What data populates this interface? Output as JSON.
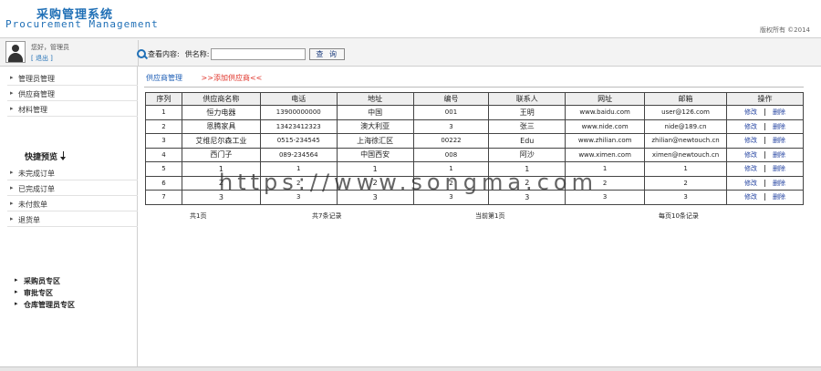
{
  "header": {
    "title_cn": "采购管理系统",
    "title_en": "Procurement Management",
    "copyright": "版权所有  ©2014"
  },
  "user": {
    "greeting": "您好，管理员",
    "logout": "[ 退出 ]"
  },
  "search": {
    "label_query": "查看内容:",
    "label_name": "供名称:",
    "value": "",
    "button": "查 询"
  },
  "sidebar": {
    "items_top": [
      "管理员管理",
      "供应商管理",
      "材料管理"
    ],
    "quick_title": "快捷预览",
    "items_quick": [
      "未完成订单",
      "已完成订单",
      "未付款单",
      "退货单"
    ],
    "items_zone": [
      "采购员专区",
      "审批专区",
      "仓库管理员专区"
    ]
  },
  "tabs": {
    "manage": "供应商管理",
    "add": ">>添加供应商<<"
  },
  "table": {
    "headers": [
      "序列",
      "供应商名称",
      "电话",
      "地址",
      "编号",
      "联系人",
      "网址",
      "邮箱",
      "操作"
    ],
    "rows": [
      [
        "1",
        "恒力电器",
        "13900000000",
        "中国",
        "001",
        "王明",
        "www.baidu.com",
        "user@126.com"
      ],
      [
        "2",
        "恩腾家具",
        "13423412323",
        "澳大利亚",
        "3",
        "张三",
        "www.nide.com",
        "nide@189.cn"
      ],
      [
        "3",
        "艾维尼尔森工业",
        "0515-234545",
        "上海徐汇区",
        "00222",
        "Edu",
        "www.zhilian.com",
        "zhilian@newtouch.cn"
      ],
      [
        "4",
        "西门子",
        "089-234564",
        "中国西安",
        "008",
        "阿沙",
        "www.ximen.com",
        "ximen@newtouch.cn"
      ],
      [
        "5",
        "1",
        "1",
        "1",
        "1",
        "1",
        "1",
        "1"
      ],
      [
        "6",
        "2",
        "2",
        "2",
        "2",
        "2",
        "2",
        "2"
      ],
      [
        "7",
        "3",
        "3",
        "3",
        "3",
        "3",
        "3",
        "3"
      ]
    ],
    "op_edit": "修改",
    "op_delete": "删除"
  },
  "pager": {
    "pages": "共1页",
    "records": "共7条记录",
    "current": "当前第1页",
    "per_page": "每页10条记录"
  },
  "watermark": "https://www.songma.com"
}
